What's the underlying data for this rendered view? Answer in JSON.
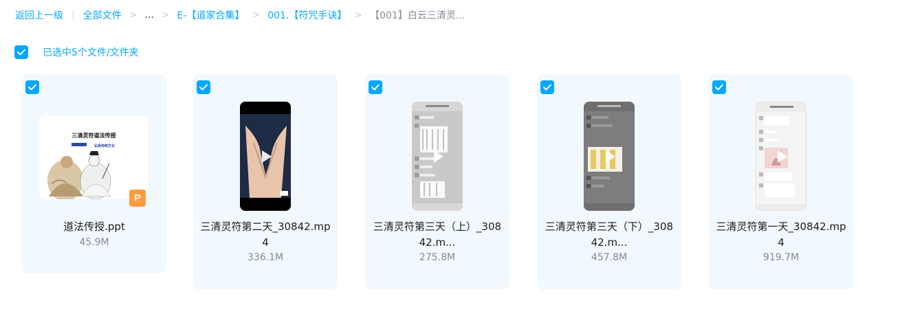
{
  "breadcrumb": {
    "back": "返回上一级",
    "separator_bar": "|",
    "all_files": "全部文件",
    "ellipsis": "...",
    "folder1": "E-【道家合集】",
    "folder2": "001.【符咒手诀】",
    "current": "【001】白云三清灵...",
    "chevron": ">"
  },
  "selection": {
    "label": "已选中5个文件/文件夹",
    "checked": true
  },
  "colors": {
    "accent": "#06a7ff",
    "card_bg": "#f1f8fe",
    "ppt_badge": "#ff9b3d"
  },
  "files": [
    {
      "name": "道法传授.ppt",
      "size": "45.9M",
      "type": "ppt",
      "thumb_title": "三清灵符道法传授",
      "thumb_subtitle": "弘扬传统文化",
      "checked": true
    },
    {
      "name": "三清灵符第二天_30842.mp4",
      "size": "336.1M",
      "type": "video",
      "checked": true
    },
    {
      "name": "三清灵符第三天（上）_30842.m...",
      "size": "275.8M",
      "type": "video",
      "checked": true
    },
    {
      "name": "三清灵符第三天（下）_30842.m...",
      "size": "457.8M",
      "type": "video",
      "checked": true
    },
    {
      "name": "三清灵符第一天_30842.mp4",
      "size": "919.7M",
      "type": "video",
      "checked": true
    }
  ]
}
